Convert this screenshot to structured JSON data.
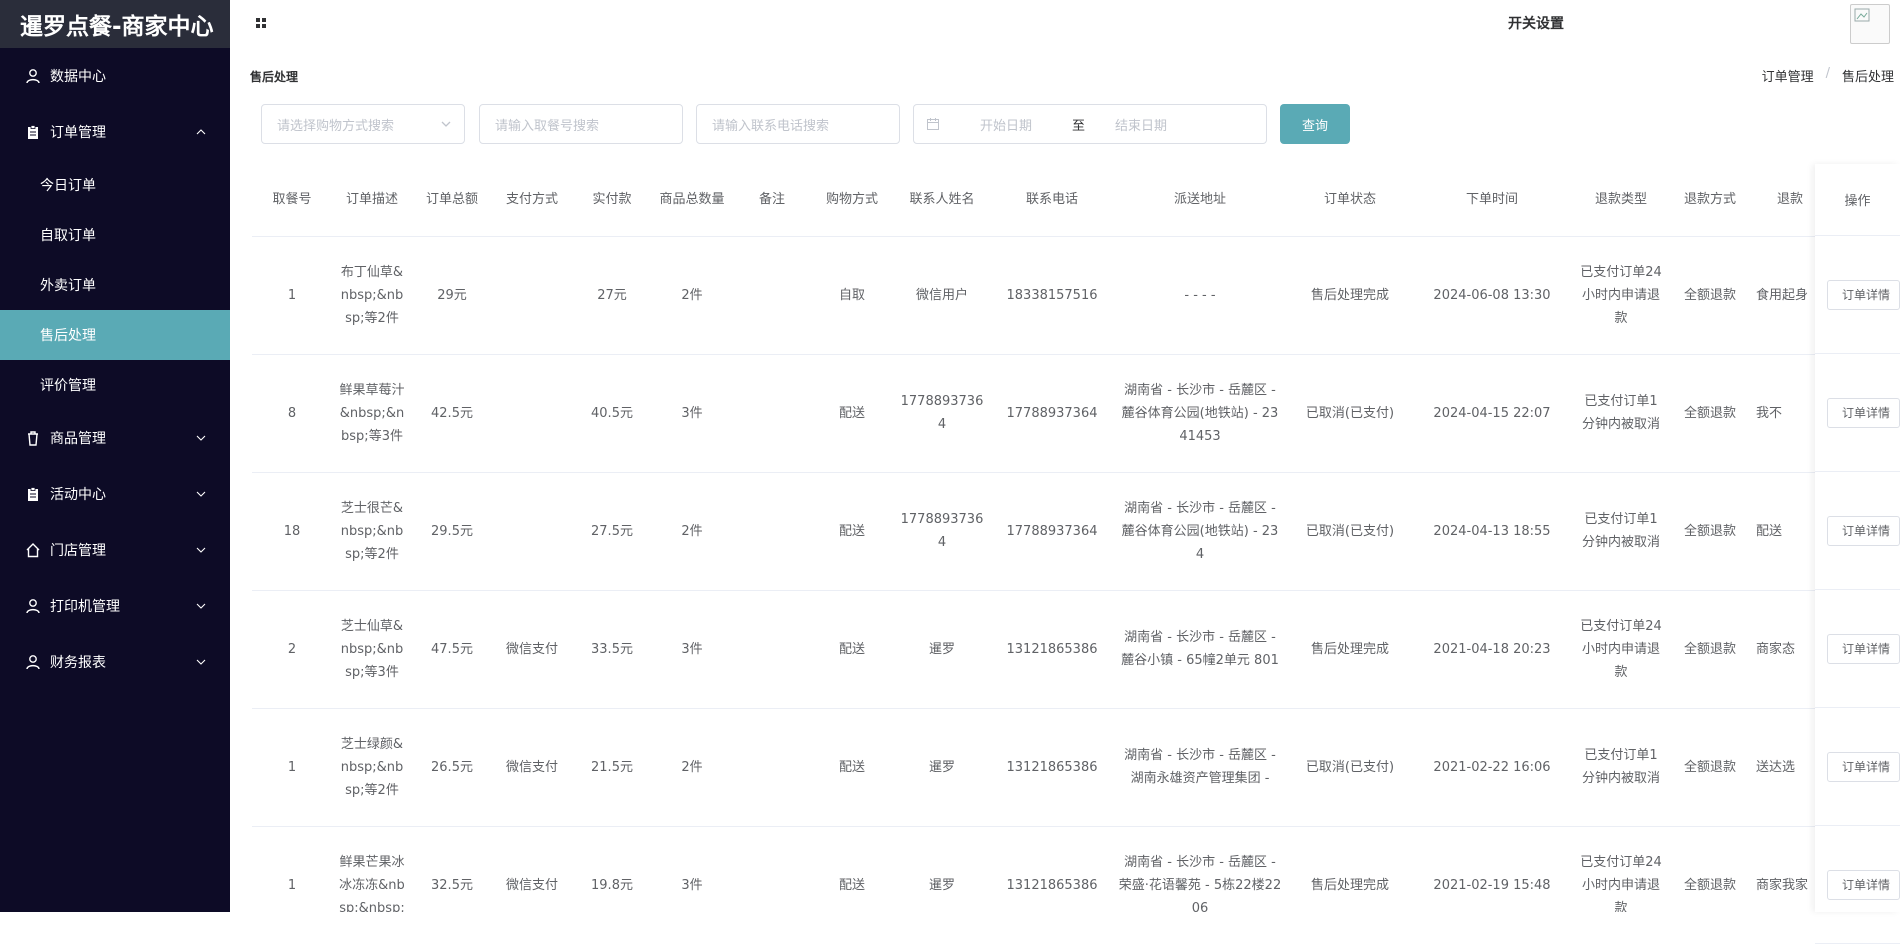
{
  "app": {
    "title": "暹罗点餐-商家中心"
  },
  "sidebar": {
    "items": [
      {
        "label": "数据中心",
        "icon": "user-icon"
      },
      {
        "label": "订单管理",
        "icon": "clipboard-icon",
        "expanded": true,
        "children": [
          "今日订单",
          "自取订单",
          "外卖订单",
          "售后处理",
          "评价管理"
        ],
        "active_child": "售后处理"
      },
      {
        "label": "商品管理",
        "icon": "trash-bin-icon"
      },
      {
        "label": "活动中心",
        "icon": "clipboard-icon"
      },
      {
        "label": "门店管理",
        "icon": "home-icon"
      },
      {
        "label": "打印机管理",
        "icon": "user-icon"
      },
      {
        "label": "财务报表",
        "icon": "user-icon"
      }
    ]
  },
  "header": {
    "settings_label": "开关设置"
  },
  "page": {
    "title": "售后处理",
    "breadcrumb": [
      "订单管理",
      "售后处理"
    ]
  },
  "filters": {
    "shopping_method_placeholder": "请选择购物方式搜索",
    "pickup_no_placeholder": "请输入取餐号搜索",
    "phone_placeholder": "请输入联系电话搜索",
    "start_date_placeholder": "开始日期",
    "date_separator": "至",
    "end_date_placeholder": "结束日期",
    "query_label": "查询"
  },
  "table": {
    "columns": [
      "取餐号",
      "订单描述",
      "订单总额",
      "支付方式",
      "实付款",
      "商品总数量",
      "备注",
      "购物方式",
      "联系人姓名",
      "联系电话",
      "派送地址",
      "订单状态",
      "下单时间",
      "退款类型",
      "退款方式",
      "退款"
    ],
    "action_header": "操作",
    "action_label": "订单详情",
    "rows": [
      [
        "1",
        "布丁仙草&nbsp;&nbsp;等2件",
        "29元",
        "",
        "27元",
        "2件",
        "",
        "自取",
        "微信用户",
        "18338157516",
        "- - - -",
        "售后处理完成",
        "2024-06-08 13:30",
        "已支付订单24小时内申请退款",
        "全额退款",
        "食用起身"
      ],
      [
        "8",
        "鲜果草莓汁&nbsp;&nbsp;等3件",
        "42.5元",
        "",
        "40.5元",
        "3件",
        "",
        "配送",
        "17788937364",
        "17788937364",
        "湖南省 - 长沙市 - 岳麓区 - 麓谷体育公园(地铁站) - 2341453",
        "已取消(已支付)",
        "2024-04-15 22:07",
        "已支付订单1分钟内被取消",
        "全额退款",
        "我不"
      ],
      [
        "18",
        "芝士很芒&nbsp;&nbsp;等2件",
        "29.5元",
        "",
        "27.5元",
        "2件",
        "",
        "配送",
        "17788937364",
        "17788937364",
        "湖南省 - 长沙市 - 岳麓区 - 麓谷体育公园(地铁站) - 234",
        "已取消(已支付)",
        "2024-04-13 18:55",
        "已支付订单1分钟内被取消",
        "全额退款",
        "配送"
      ],
      [
        "2",
        "芝士仙草&nbsp;&nbsp;等3件",
        "47.5元",
        "微信支付",
        "33.5元",
        "3件",
        "",
        "配送",
        "暹罗",
        "13121865386",
        "湖南省 - 长沙市 - 岳麓区 - 麓谷小镇 - 65幢2单元 801",
        "售后处理完成",
        "2021-04-18 20:23",
        "已支付订单24小时内申请退款",
        "全额退款",
        "商家态"
      ],
      [
        "1",
        "芝士绿颜&nbsp;&nbsp;等2件",
        "26.5元",
        "微信支付",
        "21.5元",
        "2件",
        "",
        "配送",
        "暹罗",
        "13121865386",
        "湖南省 - 长沙市 - 岳麓区 - 湖南永雄资产管理集团 -",
        "已取消(已支付)",
        "2021-02-22 16:06",
        "已支付订单1分钟内被取消",
        "全额退款",
        "送达选"
      ],
      [
        "1",
        "鲜果芒果冰冰冻冻&nbsp;&nbsp;",
        "32.5元",
        "微信支付",
        "19.8元",
        "3件",
        "",
        "配送",
        "暹罗",
        "13121865386",
        "湖南省 - 长沙市 - 岳麓区 - 荣盛·花语馨苑 - 5栋22楼2206",
        "售后处理完成",
        "2021-02-19 15:48",
        "已支付订单24小时内申请退款",
        "全额退款",
        "商家我家"
      ]
    ]
  }
}
